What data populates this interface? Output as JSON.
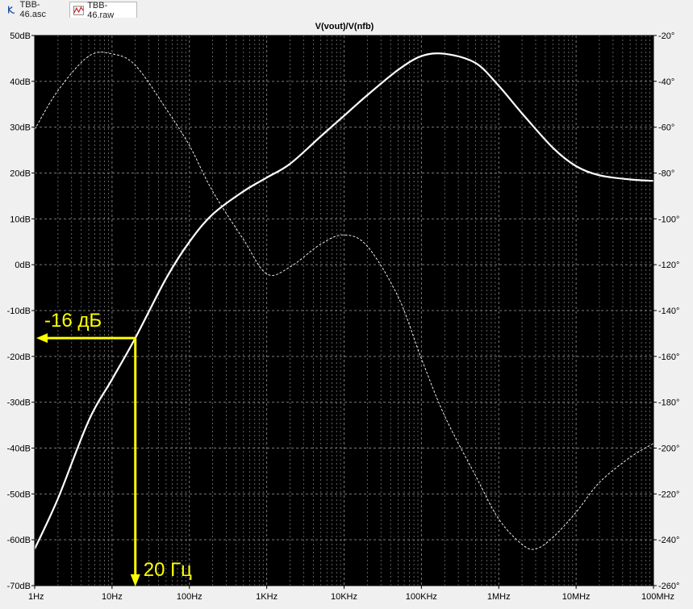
{
  "tabs": [
    {
      "label": "TBB-46.asc",
      "icon": "schematic-icon"
    },
    {
      "label": "TBB-46.raw",
      "icon": "waveform-icon"
    }
  ],
  "colors": {
    "background": "#000000",
    "trace": "#ffffff",
    "grid": "#7a7a7a",
    "annotation": "#ffff00",
    "frame_bg": "#f0f0f0"
  },
  "chart_data": {
    "type": "line",
    "title": "V(vout)/V(nfb)",
    "x_scale": "log",
    "x_unit": "Hz",
    "xlim": [
      1,
      100000000
    ],
    "x_tick_labels": [
      "1Hz",
      "10Hz",
      "100Hz",
      "1KHz",
      "10KHz",
      "100KHz",
      "1MHz",
      "10MHz",
      "100MHz"
    ],
    "y_left_lim": [
      -70,
      50
    ],
    "y_left_tick_labels": [
      "50dB",
      "40dB",
      "30dB",
      "20dB",
      "10dB",
      "0dB",
      "-10dB",
      "-20dB",
      "-30dB",
      "-40dB",
      "-50dB",
      "-60dB",
      "-70dB"
    ],
    "y_right_lim": [
      -260,
      -20
    ],
    "y_right_tick_labels": [
      "-20°",
      "-40°",
      "-60°",
      "-80°",
      "-100°",
      "-120°",
      "-140°",
      "-160°",
      "-180°",
      "-200°",
      "-220°",
      "-240°",
      "-260°"
    ],
    "grid": true,
    "series": [
      {
        "style": "solid",
        "axis": "left",
        "x": [
          1,
          2,
          5,
          10,
          20,
          50,
          100,
          200,
          500,
          1000,
          2000,
          5000,
          10000,
          20000,
          50000,
          100000,
          200000,
          500000,
          1000000,
          2000000,
          5000000,
          10000000,
          20000000,
          50000000,
          100000000
        ],
        "y": [
          -62,
          -51,
          -34,
          -25,
          -16,
          -3,
          5,
          11,
          16,
          19,
          22,
          28,
          32.5,
          37,
          42.5,
          45.5,
          46,
          44,
          39,
          33,
          25.5,
          21.5,
          19.5,
          18.6,
          18.3
        ]
      },
      {
        "style": "dashed",
        "axis": "right",
        "x": [
          1,
          2,
          5,
          10,
          20,
          50,
          100,
          200,
          500,
          1000,
          2000,
          5000,
          10000,
          20000,
          50000,
          100000,
          200000,
          500000,
          1000000,
          2000000,
          3000000,
          5000000,
          10000000,
          20000000,
          50000000,
          100000000
        ],
        "y": [
          -61,
          -44,
          -29,
          -28,
          -33,
          -52,
          -68,
          -88,
          -109,
          -124,
          -121,
          -111,
          -107,
          -112,
          -134,
          -161,
          -186,
          -212,
          -231,
          -242,
          -244,
          -239,
          -228,
          -215,
          -204,
          -198
        ]
      }
    ],
    "annotations": [
      {
        "label": "-16 дБ",
        "x": 20,
        "y": -16,
        "arrow": "to-left-axis"
      },
      {
        "label": "20 Гц",
        "x": 20,
        "y": -16,
        "arrow": "to-bottom-axis"
      }
    ]
  }
}
